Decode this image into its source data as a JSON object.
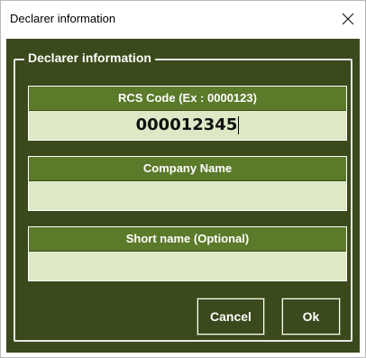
{
  "window": {
    "title": "Declarer information",
    "close_icon": "close-icon"
  },
  "group": {
    "legend": "Declarer information"
  },
  "fields": [
    {
      "header": "RCS Code (Ex : 0000123)",
      "value": "000012345",
      "placeholder": ""
    },
    {
      "header": "Company Name",
      "value": "",
      "placeholder": ""
    },
    {
      "header": "Short name (Optional)",
      "value": "",
      "placeholder": ""
    }
  ],
  "buttons": {
    "cancel_label": "Cancel",
    "ok_label": "Ok"
  },
  "colors": {
    "background": "#3a4a1c",
    "header": "#5b7a2a",
    "input": "#dde9c6"
  }
}
